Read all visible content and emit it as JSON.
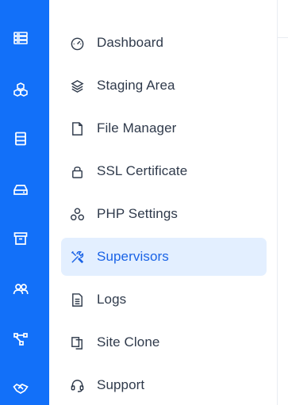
{
  "rail": {
    "icons": [
      "server-icon",
      "cubes-icon",
      "list-icon",
      "drive-icon",
      "archive-icon",
      "users-icon",
      "network-icon",
      "handshake-icon"
    ]
  },
  "menu": {
    "items": [
      {
        "label": "Dashboard",
        "icon": "speedometer-icon"
      },
      {
        "label": "Staging Area",
        "icon": "layers-icon"
      },
      {
        "label": "File Manager",
        "icon": "file-icon"
      },
      {
        "label": "SSL Certificate",
        "icon": "lock-icon"
      },
      {
        "label": "PHP Settings",
        "icon": "cubes-icon"
      },
      {
        "label": "Supervisors",
        "icon": "tools-icon",
        "active": true
      },
      {
        "label": "Logs",
        "icon": "document-icon"
      },
      {
        "label": "Site Clone",
        "icon": "copy-icon"
      },
      {
        "label": "Support",
        "icon": "headset-icon"
      }
    ]
  },
  "colors": {
    "rail_bg": "#1270f9",
    "active_bg": "#e3efff",
    "active_text": "#1a63e6",
    "text": "#2f3a4b"
  }
}
